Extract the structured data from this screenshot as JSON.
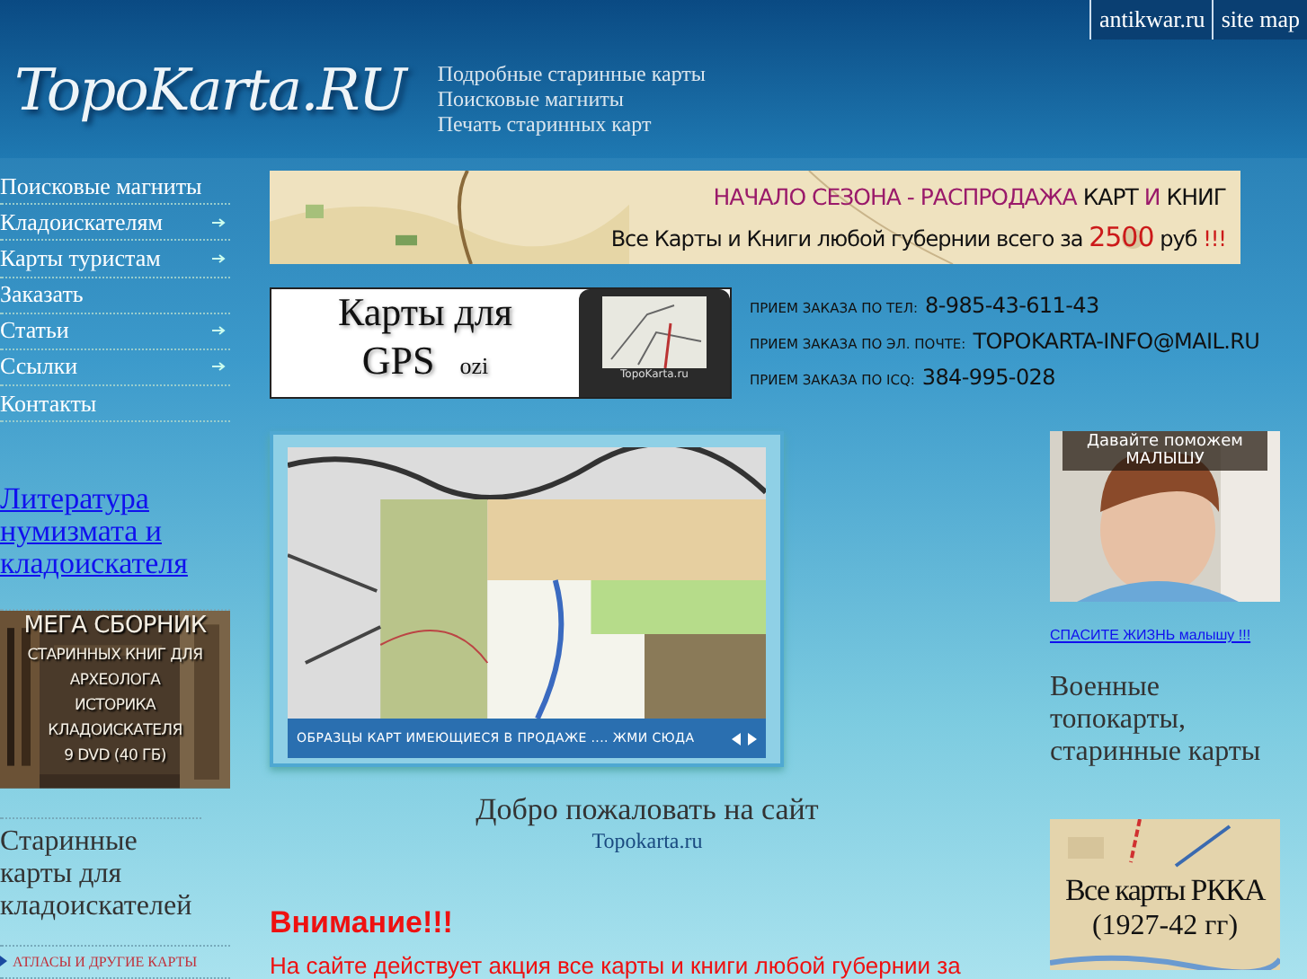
{
  "top_links": [
    {
      "label": "antikwar.ru"
    },
    {
      "label": "site map"
    }
  ],
  "logo": "TopoKarta.RU",
  "taglines": [
    "Подробные старинные карты",
    "Поисковые магниты",
    "Печать старинных карт"
  ],
  "nav": [
    {
      "label": "Поисковые магниты",
      "has_submenu": false
    },
    {
      "label": "Кладоискателям",
      "has_submenu": true
    },
    {
      "label": "Карты туристам",
      "has_submenu": true
    },
    {
      "label": "Заказать",
      "has_submenu": false
    },
    {
      "label": "Статьи",
      "has_submenu": true
    },
    {
      "label": "Ссылки",
      "has_submenu": true
    },
    {
      "label": "Контакты",
      "has_submenu": false
    }
  ],
  "literature_link": "Литература нумизмата и кладоискателя",
  "mega_banner": {
    "lines": [
      "МЕГА СБОРНИК",
      "СТАРИННЫХ КНИГ ДЛЯ",
      "АРХЕОЛОГА",
      "ИСТОРИКА",
      "КЛАДОИСКАТЕЛЯ",
      "9 DVD (40 ГБ)"
    ]
  },
  "left_heading": "Старинные карты для кладоискателей",
  "left_links": [
    "АТЛАСЫ И ДРУГИЕ КАРТЫ"
  ],
  "sale_banner": {
    "lines": [
      [
        {
          "text": "НАЧАЛО СЕЗОНА - РАСПРОДАЖА",
          "accent": true
        },
        {
          "text": "КАРТ",
          "accent": false
        },
        {
          "text": "И",
          "accent": true
        },
        {
          "text": "КНИГ",
          "accent": false
        }
      ],
      [
        {
          "text": "Все Карты и Книги любой губернии всего за",
          "accent": false
        },
        {
          "text": "2500",
          "accent": true
        },
        {
          "text": "руб",
          "accent": false
        },
        {
          "text": "!!!",
          "accent": true
        }
      ]
    ]
  },
  "gps_banner": {
    "title": "Карты для",
    "subtitle": "GPS",
    "tag": "ozi",
    "device_label": "TopoKarta.ru"
  },
  "contacts": [
    {
      "label": "ПРИЕМ ЗАКАЗА ПО ТЕЛ:",
      "value": "8-985-43-611-43"
    },
    {
      "label": "ПРИЕМ ЗАКАЗА ПО ЭЛ. ПОЧТЕ:",
      "value": "TOPOKARTA-INFO@MAIL.RU"
    },
    {
      "label": "ПРИЕМ ЗАКАЗА ПО ICQ:",
      "value": "384-995-028"
    }
  ],
  "slideshow": {
    "caption": "ОБРАЗЦЫ КАРТ ИМЕЮЩИЕСЯ В ПРОДАЖЕ .... ЖМИ СЮДА"
  },
  "welcome": {
    "title": "Добро пожаловать на сайт",
    "site": "Topokarta.ru"
  },
  "notice": {
    "title": "Внимание!!!",
    "text": "На сайте действует акция все карты и книги любой губернии за"
  },
  "help_banner": {
    "caption": "Давайте поможем МАЛЫШУ",
    "link": "СПАСИТЕ ЖИЗНЬ малышу !!!"
  },
  "right_heading": "Военные топокарты, старинные карты",
  "rkka_banner": {
    "title": "Все карты РККА",
    "years": "(1927-42 гг)"
  }
}
